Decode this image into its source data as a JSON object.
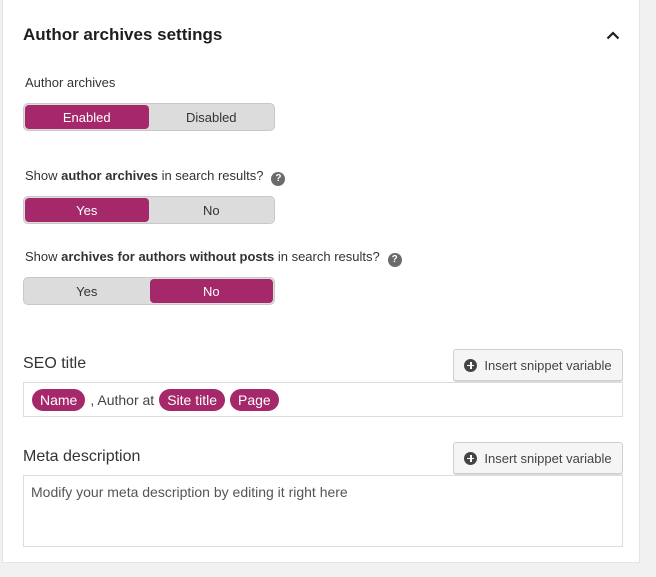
{
  "section": {
    "title": "Author archives settings",
    "collapse_icon": "chevron-up-icon"
  },
  "author_archives": {
    "label": "Author archives",
    "options": [
      "Enabled",
      "Disabled"
    ],
    "selected": "Enabled"
  },
  "show_archives": {
    "label_prefix": "Show ",
    "label_bold": "author archives",
    "label_suffix": " in search results?",
    "help_icon": "?",
    "options": [
      "Yes",
      "No"
    ],
    "selected": "Yes"
  },
  "show_no_posts": {
    "label_prefix": "Show ",
    "label_bold": "archives for authors without posts",
    "label_suffix": " in search results?",
    "help_icon": "?",
    "options": [
      "Yes",
      "No"
    ],
    "selected": "No"
  },
  "seo_title": {
    "label": "SEO title",
    "insert_button": "Insert snippet variable",
    "tokens": [
      "Name"
    ],
    "text_between": ", Author at",
    "tokens_after": [
      "Site title",
      "Page"
    ]
  },
  "meta_description": {
    "label": "Meta description",
    "insert_button": "Insert snippet variable",
    "placeholder": "Modify your meta description by editing it right here"
  },
  "colors": {
    "accent": "#a4286a",
    "toggle_bg": "#dcdcdc"
  }
}
